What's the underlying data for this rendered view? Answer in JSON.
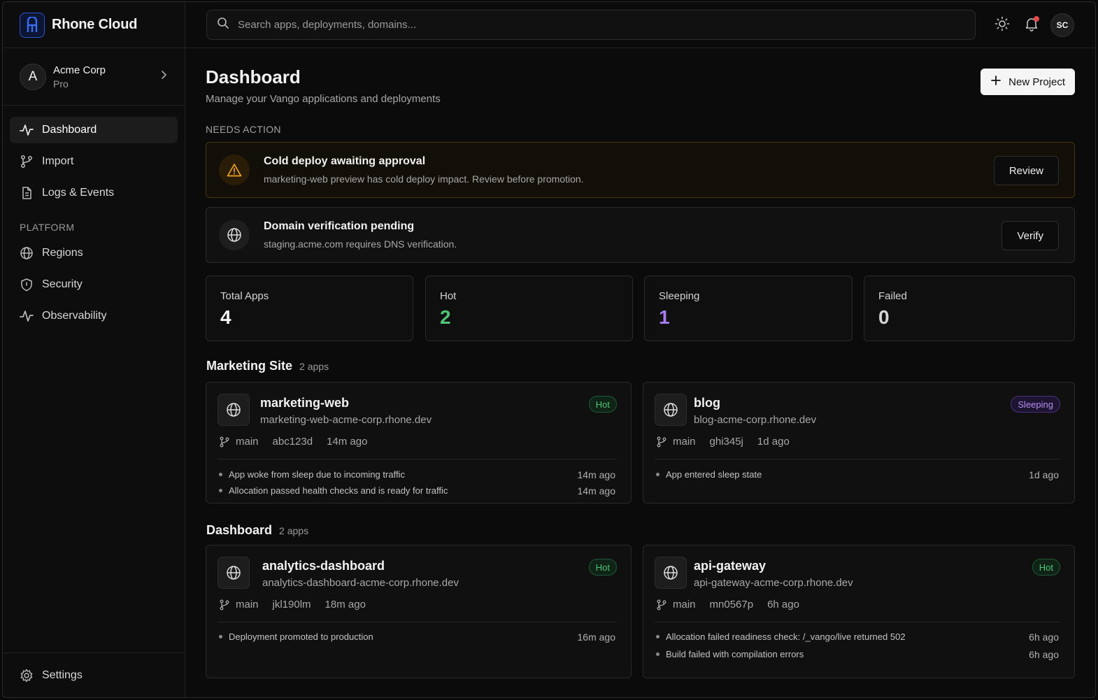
{
  "brand": {
    "name": "Rhone Cloud"
  },
  "org": {
    "initial": "A",
    "name": "Acme Corp",
    "plan": "Pro"
  },
  "nav": {
    "items": [
      {
        "label": "Dashboard",
        "icon": "activity-icon",
        "active": true
      },
      {
        "label": "Import",
        "icon": "git-branch-icon"
      },
      {
        "label": "Logs & Events",
        "icon": "file-text-icon"
      }
    ],
    "section": "PLATFORM",
    "platform": [
      {
        "label": "Regions",
        "icon": "globe-icon"
      },
      {
        "label": "Security",
        "icon": "shield-icon"
      },
      {
        "label": "Observability",
        "icon": "activity-icon"
      }
    ],
    "settings": "Settings"
  },
  "topbar": {
    "search_placeholder": "Search apps, deployments, domains...",
    "user_initials": "SC"
  },
  "page": {
    "title": "Dashboard",
    "subtitle": "Manage your Vango applications and deployments",
    "new_project": "New Project",
    "needs_action": "NEEDS ACTION"
  },
  "actions": [
    {
      "title": "Cold deploy awaiting approval",
      "desc": "marketing-web preview has cold deploy impact. Review before promotion.",
      "button": "Review",
      "icon": "warning-icon"
    },
    {
      "title": "Domain verification pending",
      "desc": "staging.acme.com requires DNS verification.",
      "button": "Verify",
      "icon": "globe-icon"
    }
  ],
  "stats": [
    {
      "label": "Total Apps",
      "value": "4",
      "color": "#f2f2f2"
    },
    {
      "label": "Hot",
      "value": "2",
      "color": "#4fc476"
    },
    {
      "label": "Sleeping",
      "value": "1",
      "color": "#a67cf0"
    },
    {
      "label": "Failed",
      "value": "0",
      "color": "#d4d4d4"
    }
  ],
  "groups": [
    {
      "name": "Marketing Site",
      "count": "2 apps",
      "apps": [
        {
          "name": "marketing-web",
          "host": "marketing-web-acme-corp.rhone.dev",
          "status": "Hot",
          "branch": "main",
          "commit": "abc123d",
          "age": "14m ago",
          "events": [
            {
              "msg": "App woke from sleep due to incoming traffic",
              "time": "14m ago"
            },
            {
              "msg": "Allocation passed health checks and is ready for traffic",
              "time": "14m ago"
            }
          ]
        },
        {
          "name": "blog",
          "host": "blog-acme-corp.rhone.dev",
          "status": "Sleeping",
          "branch": "main",
          "commit": "ghi345j",
          "age": "1d ago",
          "events": [
            {
              "msg": "App entered sleep state",
              "time": "1d ago"
            }
          ]
        }
      ]
    },
    {
      "name": "Dashboard",
      "count": "2 apps",
      "apps": [
        {
          "name": "analytics-dashboard",
          "host": "analytics-dashboard-acme-corp.rhone.dev",
          "status": "Hot",
          "branch": "main",
          "commit": "jkl190lm",
          "age": "18m ago",
          "events": [
            {
              "msg": "Deployment promoted to production",
              "time": "16m ago"
            }
          ]
        },
        {
          "name": "api-gateway",
          "host": "api-gateway-acme-corp.rhone.dev",
          "status": "Hot",
          "branch": "main",
          "commit": "mn0567p",
          "age": "6h ago",
          "events": [
            {
              "msg": "Allocation failed readiness check: /_vango/live returned 502",
              "time": "6h ago"
            },
            {
              "msg": "Build failed with compilation errors",
              "time": "6h ago"
            }
          ]
        }
      ]
    }
  ]
}
